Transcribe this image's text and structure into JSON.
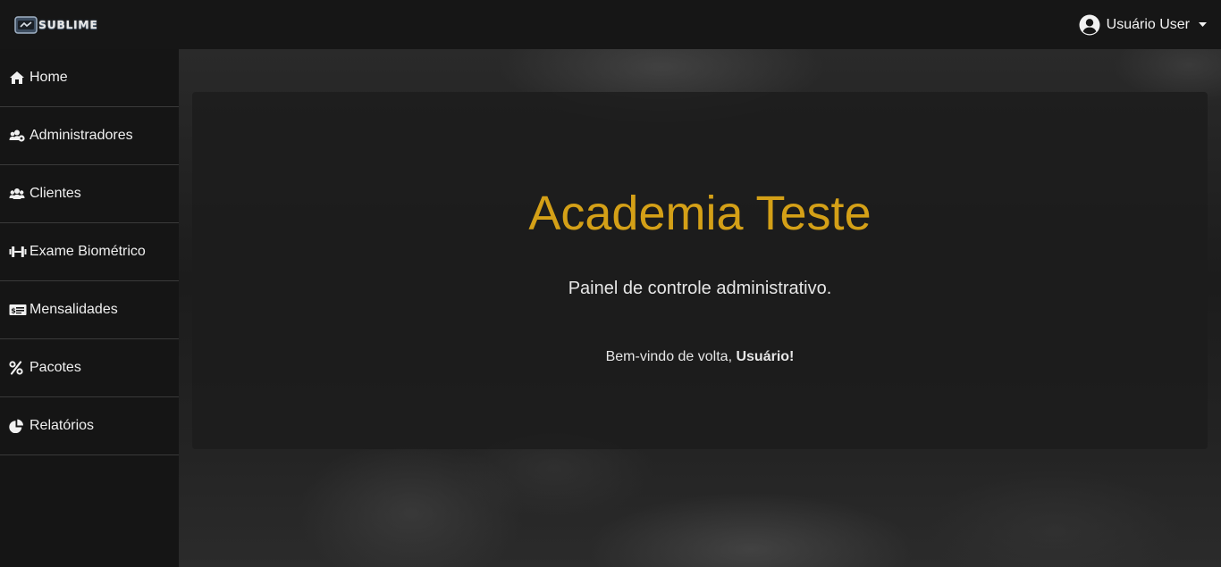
{
  "brand": {
    "name": "SUBLIME",
    "icon": "logo-icon"
  },
  "user_menu": {
    "label": "Usuário User",
    "icon": "user-circle-icon",
    "caret": "caret-down-icon"
  },
  "sidebar": {
    "items": [
      {
        "label": "Home",
        "icon": "home-icon"
      },
      {
        "label": "Administradores",
        "icon": "users-cog-icon"
      },
      {
        "label": "Clientes",
        "icon": "users-icon"
      },
      {
        "label": "Exame Biométrico",
        "icon": "dumbbell-icon"
      },
      {
        "label": "Mensalidades",
        "icon": "money-check-icon"
      },
      {
        "label": "Pacotes",
        "icon": "percent-icon"
      },
      {
        "label": "Relatórios",
        "icon": "pie-chart-icon"
      }
    ]
  },
  "hero": {
    "title": "Academia Teste",
    "subtitle": "Painel de controle administrativo.",
    "welcome_prefix": "Bem-vindo de volta, ",
    "welcome_name": "Usuário",
    "welcome_suffix": "!"
  },
  "colors": {
    "accent": "#d4a017",
    "topbar": "#161616",
    "sidebar": "#151515",
    "text": "#f0f0f0"
  }
}
